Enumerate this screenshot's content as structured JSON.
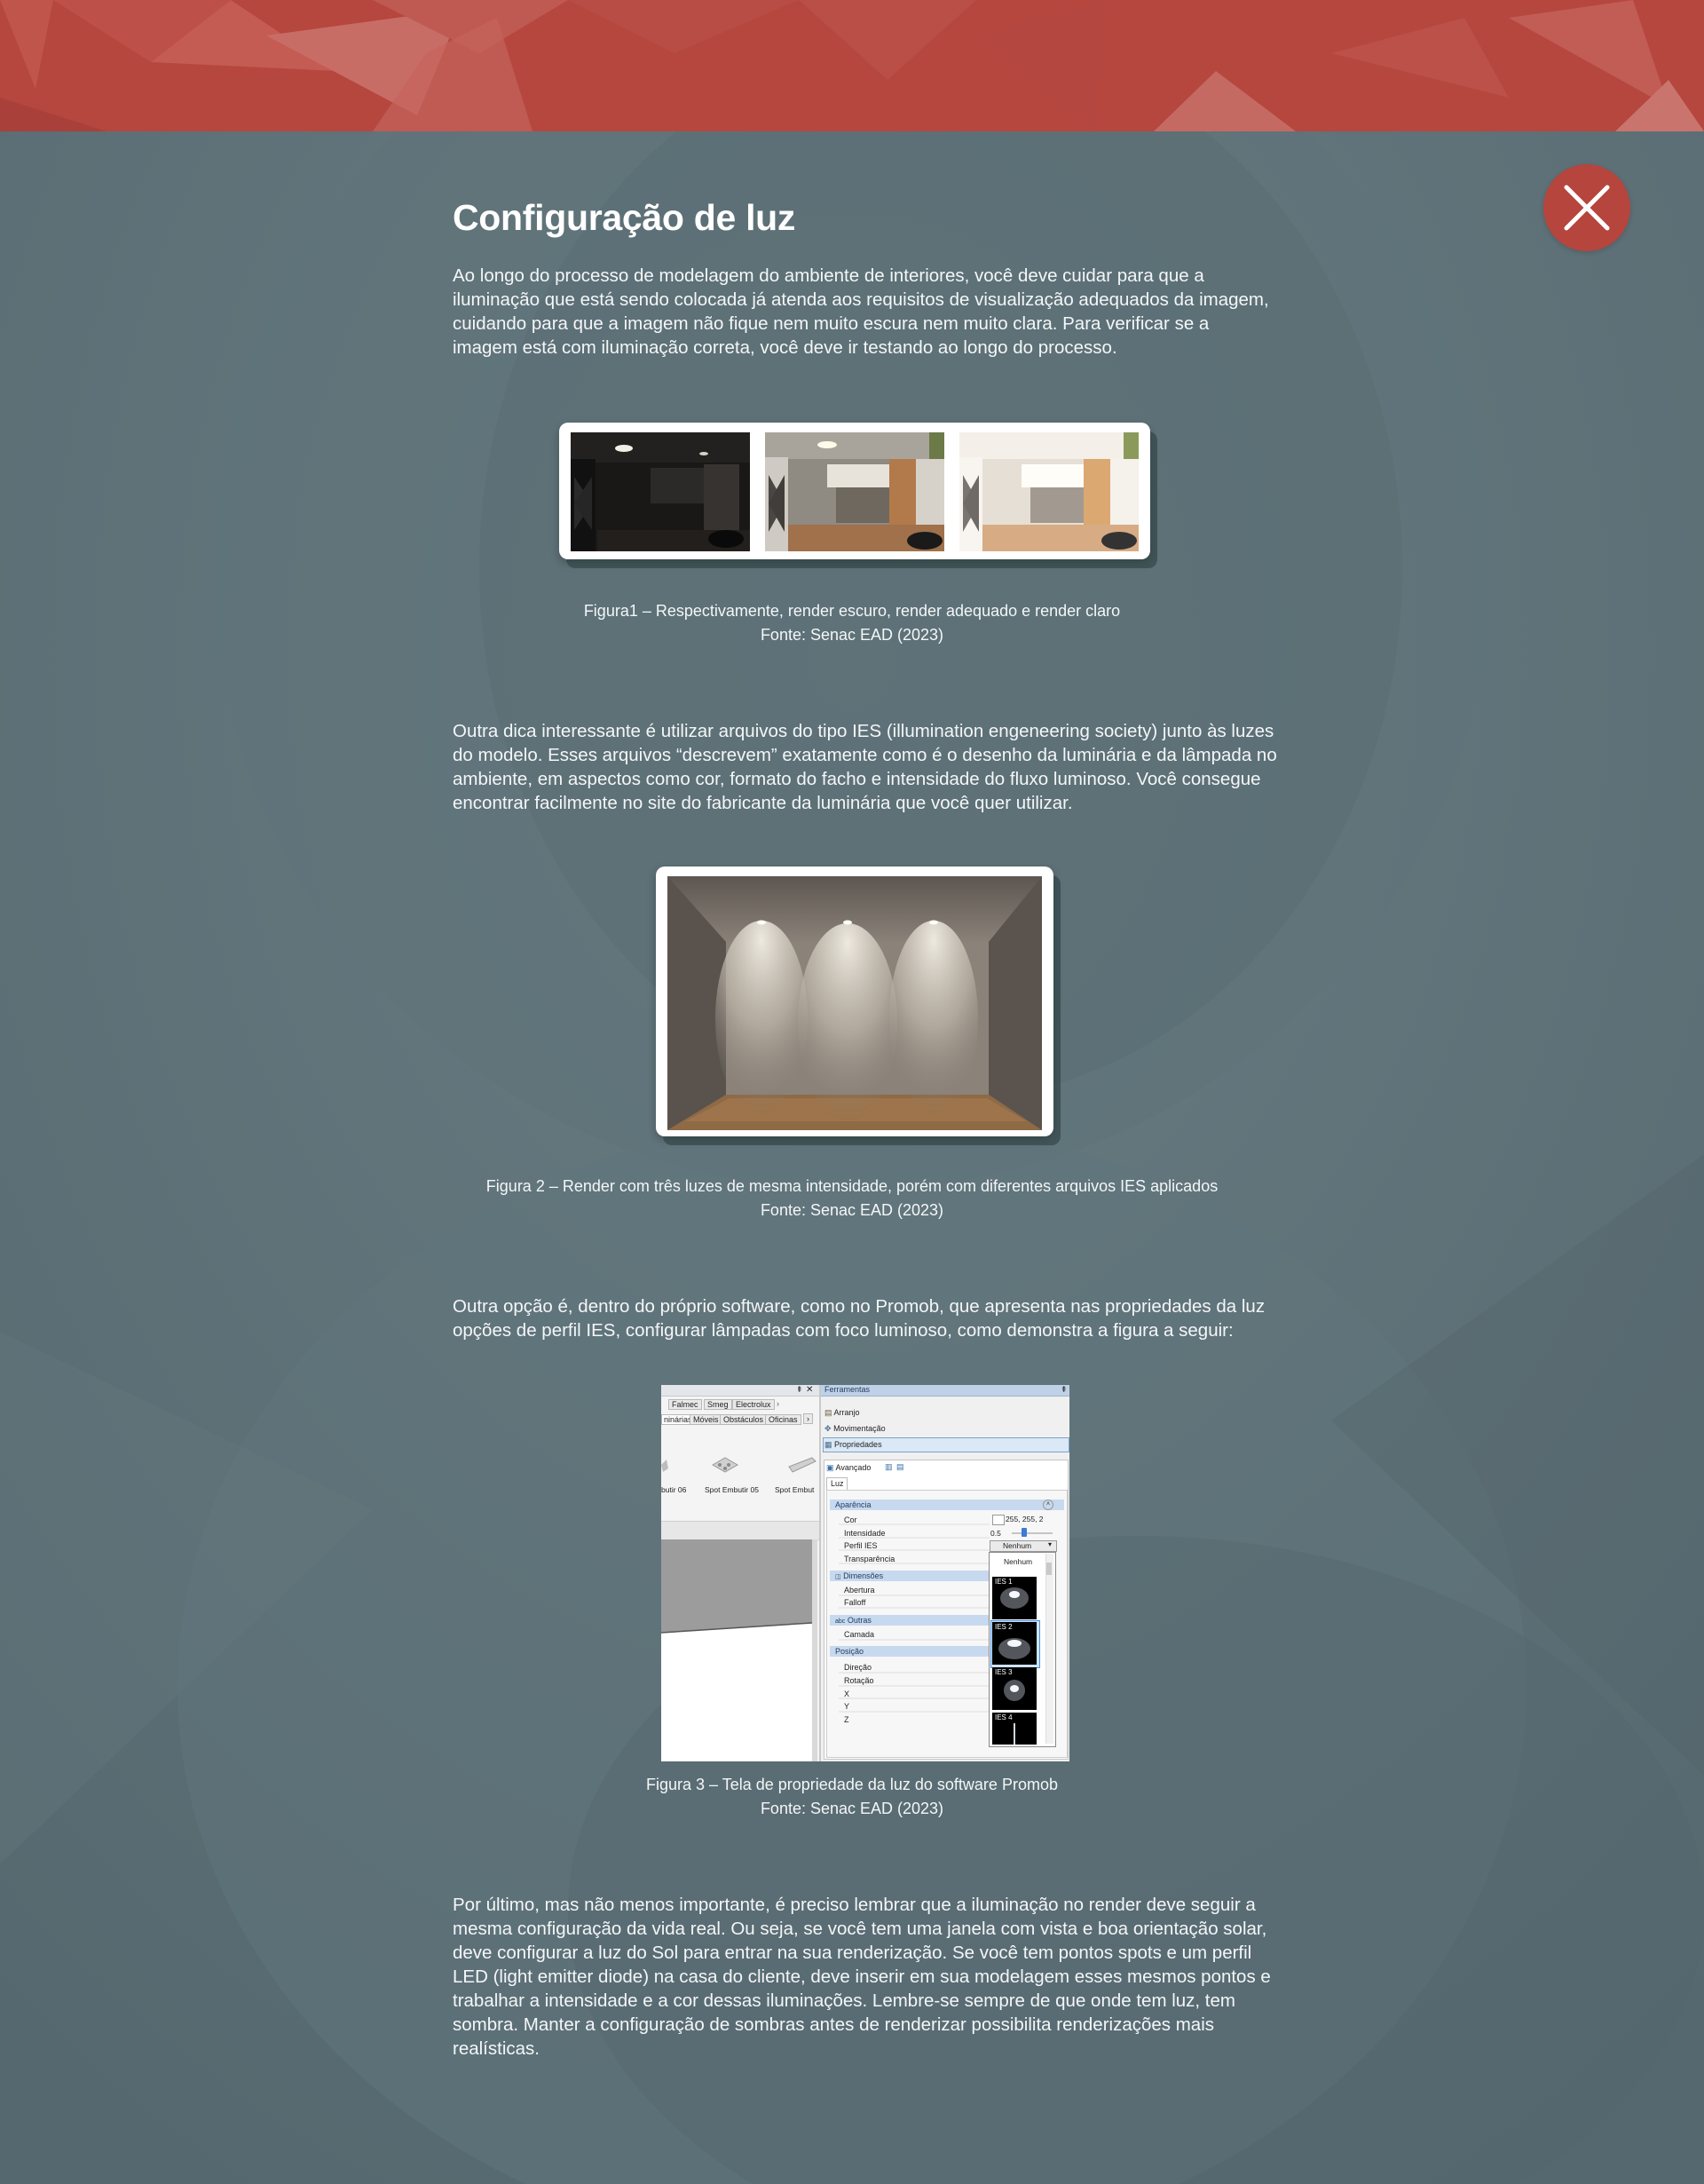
{
  "title": "Configuração de luz",
  "paragraphs": {
    "p1": "Ao longo do processo de modelagem do ambiente de interiores, você deve cuidar para que a iluminação que está sendo colocada já atenda aos requisitos de visualização adequados da imagem, cuidando para que a imagem não fique nem muito escura nem muito clara. Para verificar se a imagem está com iluminação correta, você deve ir testando ao longo do processo.",
    "p2": "Outra dica interessante é utilizar arquivos do tipo IES (illumination engeneering society) junto às luzes do modelo. Esses arquivos “descrevem” exatamente como é o desenho da luminária e da lâmpada no ambiente, em aspectos como cor, formato do facho e intensidade do fluxo luminoso. Você consegue encontrar facilmente no site do fabricante da luminária que você quer utilizar.",
    "p3": "Outra opção é, dentro do próprio software, como no Promob, que apresenta nas propriedades da luz opções de perfil IES, configurar lâmpadas com foco luminoso, como demonstra a figura a seguir:",
    "p4": "Por último, mas não menos importante, é preciso lembrar que a iluminação no render deve seguir a mesma configuração da vida real. Ou seja, se você tem uma janela com vista e boa orientação solar, deve configurar a luz do Sol para entrar na sua renderização. Se você tem pontos spots e um perfil LED (light emitter diode) na casa do cliente, deve inserir em sua modelagem esses mesmos pontos e trabalhar a intensidade e a cor dessas iluminações. Lembre-se sempre de que onde tem luz, tem sombra. Manter a configuração de sombras antes de renderizar possibilita renderizações mais realísticas."
  },
  "figures": {
    "fig1": {
      "caption": "Figura1 – Respectivamente, render escuro, render adequado e render claro",
      "source": "Fonte: Senac EAD (2023)"
    },
    "fig2": {
      "caption": "Figura 2 – Render com três luzes de mesma intensidade, porém com diferentes arquivos IES aplicados",
      "source": "Fonte: Senac EAD (2023)"
    },
    "fig3": {
      "caption": "Figura 3 – Tela de propriedade da luz do software Promob",
      "source": "Fonte: Senac EAD (2023)"
    }
  },
  "promob": {
    "top_tabs": [
      "Falmec",
      "Smeg",
      "Electrolux"
    ],
    "sub_tabs": [
      "ninárias",
      "Móveis",
      "Obstáculos",
      "Oficinas"
    ],
    "items": [
      "butir 06",
      "Spot Embutir 05",
      "Spot Embut"
    ],
    "panel_title": "Ferramentas",
    "tools": [
      "Arranjo",
      "Movimentação",
      "Propriedades"
    ],
    "advanced_label": "Avançado",
    "light_tab": "Luz",
    "sections": {
      "appearance": "Aparência",
      "dimensions": "Dimensões",
      "others": "Outras",
      "position": "Posição"
    },
    "props": {
      "color": "Cor",
      "color_value": "255, 255, 2",
      "intensity": "Intensidade",
      "intensity_value": "0.5",
      "ies": "Perfil IES",
      "ies_value": "Nenhum",
      "transparency": "Transparência",
      "aperture": "Abertura",
      "falloff": "Falloff",
      "layer": "Camada",
      "direction": "Direção",
      "rotation": "Rotação",
      "x": "X",
      "y": "Y",
      "z": "Z"
    },
    "dropdown": [
      "Nenhum",
      "IES 1",
      "IES 2",
      "IES 3",
      "IES 4"
    ]
  },
  "colors": {
    "topbar": "#b5473f",
    "background": "#5b6f78",
    "close_button": "#b5453d"
  },
  "icons": {
    "close": "close-icon"
  }
}
